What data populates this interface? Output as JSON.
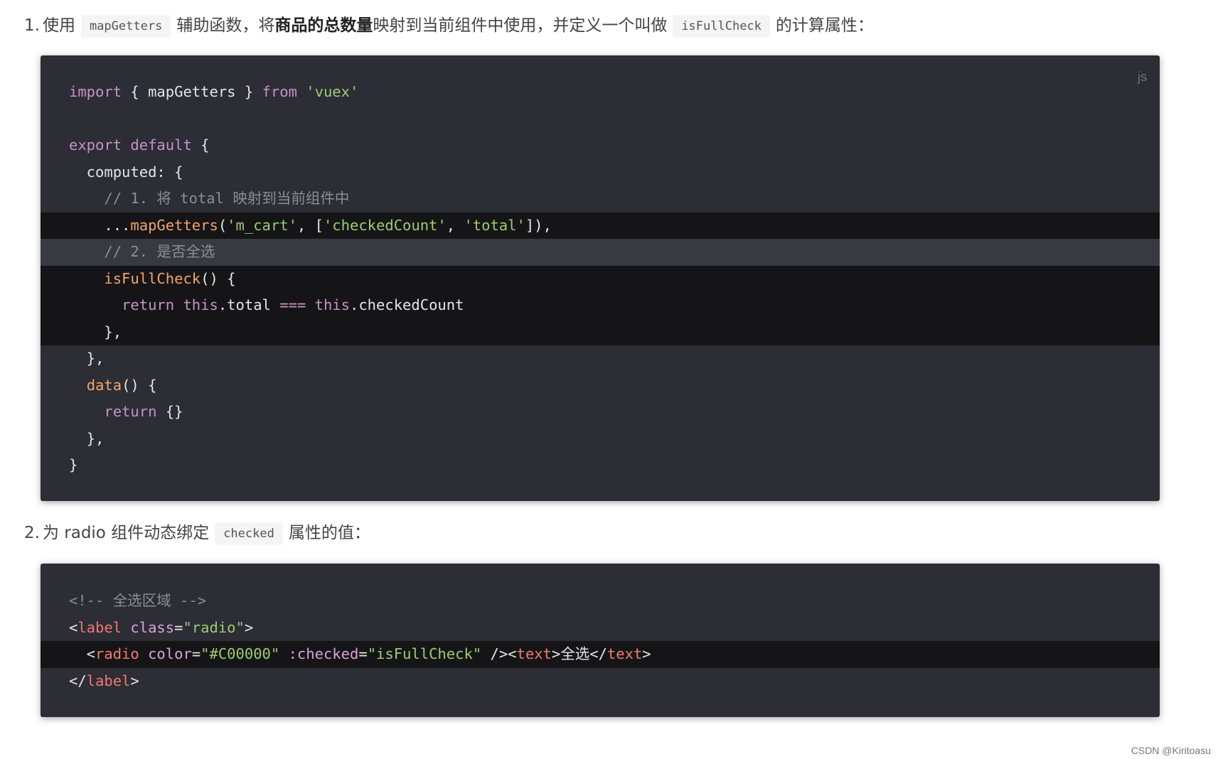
{
  "step1": {
    "num": "1.",
    "text_a": "使用",
    "code_a": "mapGetters",
    "text_b": "辅助函数，将",
    "bold": "商品的总数量",
    "text_c": "映射到当前组件中使用，并定义一个叫做",
    "code_b": "isFullCheck",
    "text_d": "的计算属性："
  },
  "block1": {
    "lang": "js",
    "lines": {
      "l1": {
        "t1": "import",
        "t2": " { mapGetters } ",
        "t3": "from",
        "t4": " ",
        "t5": "'vuex'"
      },
      "l3": {
        "t1": "export",
        "t2": " ",
        "t3": "default",
        "t4": " {"
      },
      "l4": {
        "t1": "  computed",
        "t2": ": {"
      },
      "l5": {
        "t1": "    // 1. 将 total 映射到当前组件中"
      },
      "l6": {
        "t1": "    ...",
        "t2": "mapGetters",
        "t3": "(",
        "t4": "'m_cart'",
        "t5": ", [",
        "t6": "'checkedCount'",
        "t7": ", ",
        "t8": "'total'",
        "t9": "]),"
      },
      "l7": {
        "t1": "    // 2. 是否全选"
      },
      "l8": {
        "t1": "    ",
        "t2": "isFullCheck",
        "t3": "() {"
      },
      "l9": {
        "t1": "      ",
        "t2": "return",
        "t3": " ",
        "t4": "this",
        "t5": ".total ",
        "t6": "===",
        "t7": " ",
        "t8": "this",
        "t9": ".checkedCount"
      },
      "l10": {
        "t1": "    },"
      },
      "l11": {
        "t1": "  },"
      },
      "l12": {
        "t1": "  ",
        "t2": "data",
        "t3": "() {"
      },
      "l13": {
        "t1": "    ",
        "t2": "return",
        "t3": " {}"
      },
      "l14": {
        "t1": "  },"
      },
      "l15": {
        "t1": "}"
      }
    }
  },
  "step2": {
    "num": "2.",
    "text_a": "为 radio 组件动态绑定",
    "code_a": "checked",
    "text_b": "属性的值："
  },
  "block2": {
    "lines": {
      "l1": {
        "t1": "<!-- 全选区域 -->"
      },
      "l2": {
        "t1": "<",
        "t2": "label",
        "t3": " ",
        "t4": "class",
        "t5": "=",
        "t6": "\"radio\"",
        "t7": ">"
      },
      "l3": {
        "t1": "  <",
        "t2": "radio",
        "t3": " ",
        "t4": "color",
        "t5": "=",
        "t6": "\"#C00000\"",
        "t7": " ",
        "t8": ":checked",
        "t9": "=",
        "t10": "\"isFullCheck\"",
        "t11": " /><",
        "t12": "text",
        "t13": ">全选</",
        "t14": "text",
        "t15": ">"
      },
      "l4": {
        "t1": "</",
        "t2": "label",
        "t3": ">"
      }
    }
  },
  "watermark": "CSDN @Kiritoasu",
  "colors": {
    "code_bg": "#2c2d35",
    "highlight_bg": "#151517",
    "keyword": "#c792c6",
    "function": "#f0a56c",
    "string": "#9ccc72",
    "comment": "#8b8e97",
    "tag": "#f07a6f"
  }
}
